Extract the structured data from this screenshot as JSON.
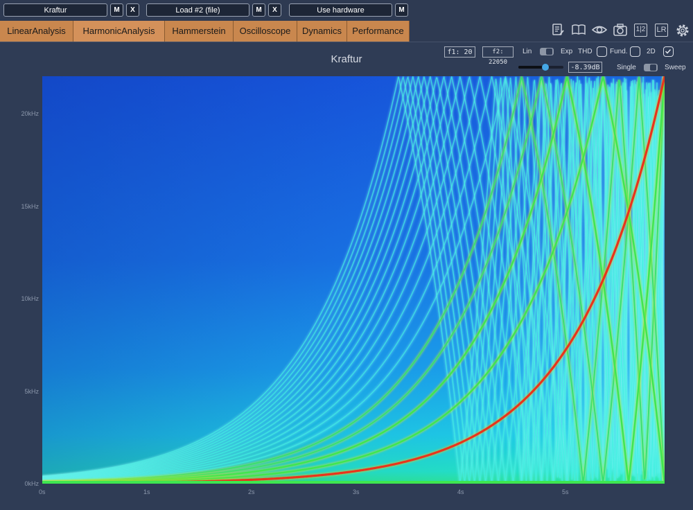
{
  "topbar": {
    "slot1_label": "Kraftur",
    "slot2_label": "Load #2 (file)",
    "slot3_label": "Use hardware",
    "mute_label": "M",
    "close_label": "X"
  },
  "tabs": [
    {
      "label": "LinearAnalysis"
    },
    {
      "label": "HarmonicAnalysis"
    },
    {
      "label": "Hammerstein"
    },
    {
      "label": "Oscilloscope"
    },
    {
      "label": "Dynamics"
    },
    {
      "label": "Performance"
    }
  ],
  "active_tab": "HarmonicAnalysis",
  "toolbar_icons": [
    "notes-icon",
    "book-icon",
    "eye-icon",
    "camera-icon",
    "split-1-2-icon",
    "lr-icon",
    "gear-icon"
  ],
  "toolbar_labels": {
    "split": "1|2",
    "lr": "LR"
  },
  "controls": {
    "f1": "f1: 20",
    "f2": "f2: 22050",
    "lin_label": "Lin",
    "exp_label": "Exp",
    "thd_label": "THD",
    "fund_label": "Fund.",
    "twod_label": "2D",
    "twod_checked": true,
    "gain_value": "-8.39dB",
    "gain_level": 0.6,
    "single_label": "Single",
    "sweep_label": "Sweep"
  },
  "chart_data": {
    "type": "heatmap",
    "title": "Kraftur",
    "xlabel": "",
    "ylabel": "",
    "x_ticks": [
      "0s",
      "1s",
      "2s",
      "3s",
      "4s",
      "5s"
    ],
    "y_ticks": [
      "0kHz",
      "5kHz",
      "10kHz",
      "15kHz",
      "20kHz"
    ],
    "xlim": [
      0,
      5.95
    ],
    "ylim": [
      0,
      22050
    ],
    "sweep": {
      "f_start": 20,
      "f_end": 22050,
      "duration": 5.95,
      "scale": "exp"
    },
    "harmonics": [
      1,
      2,
      3,
      4,
      5,
      6,
      7,
      8,
      9,
      10,
      11,
      12,
      13,
      14,
      15,
      16,
      17,
      18,
      19,
      20
    ],
    "colormap": [
      "#1f5fe0",
      "#1ea0f0",
      "#22d6e8",
      "#2cf0b0",
      "#3ee650",
      "#c8e62c",
      "#f0b020",
      "#e83a1c"
    ]
  }
}
